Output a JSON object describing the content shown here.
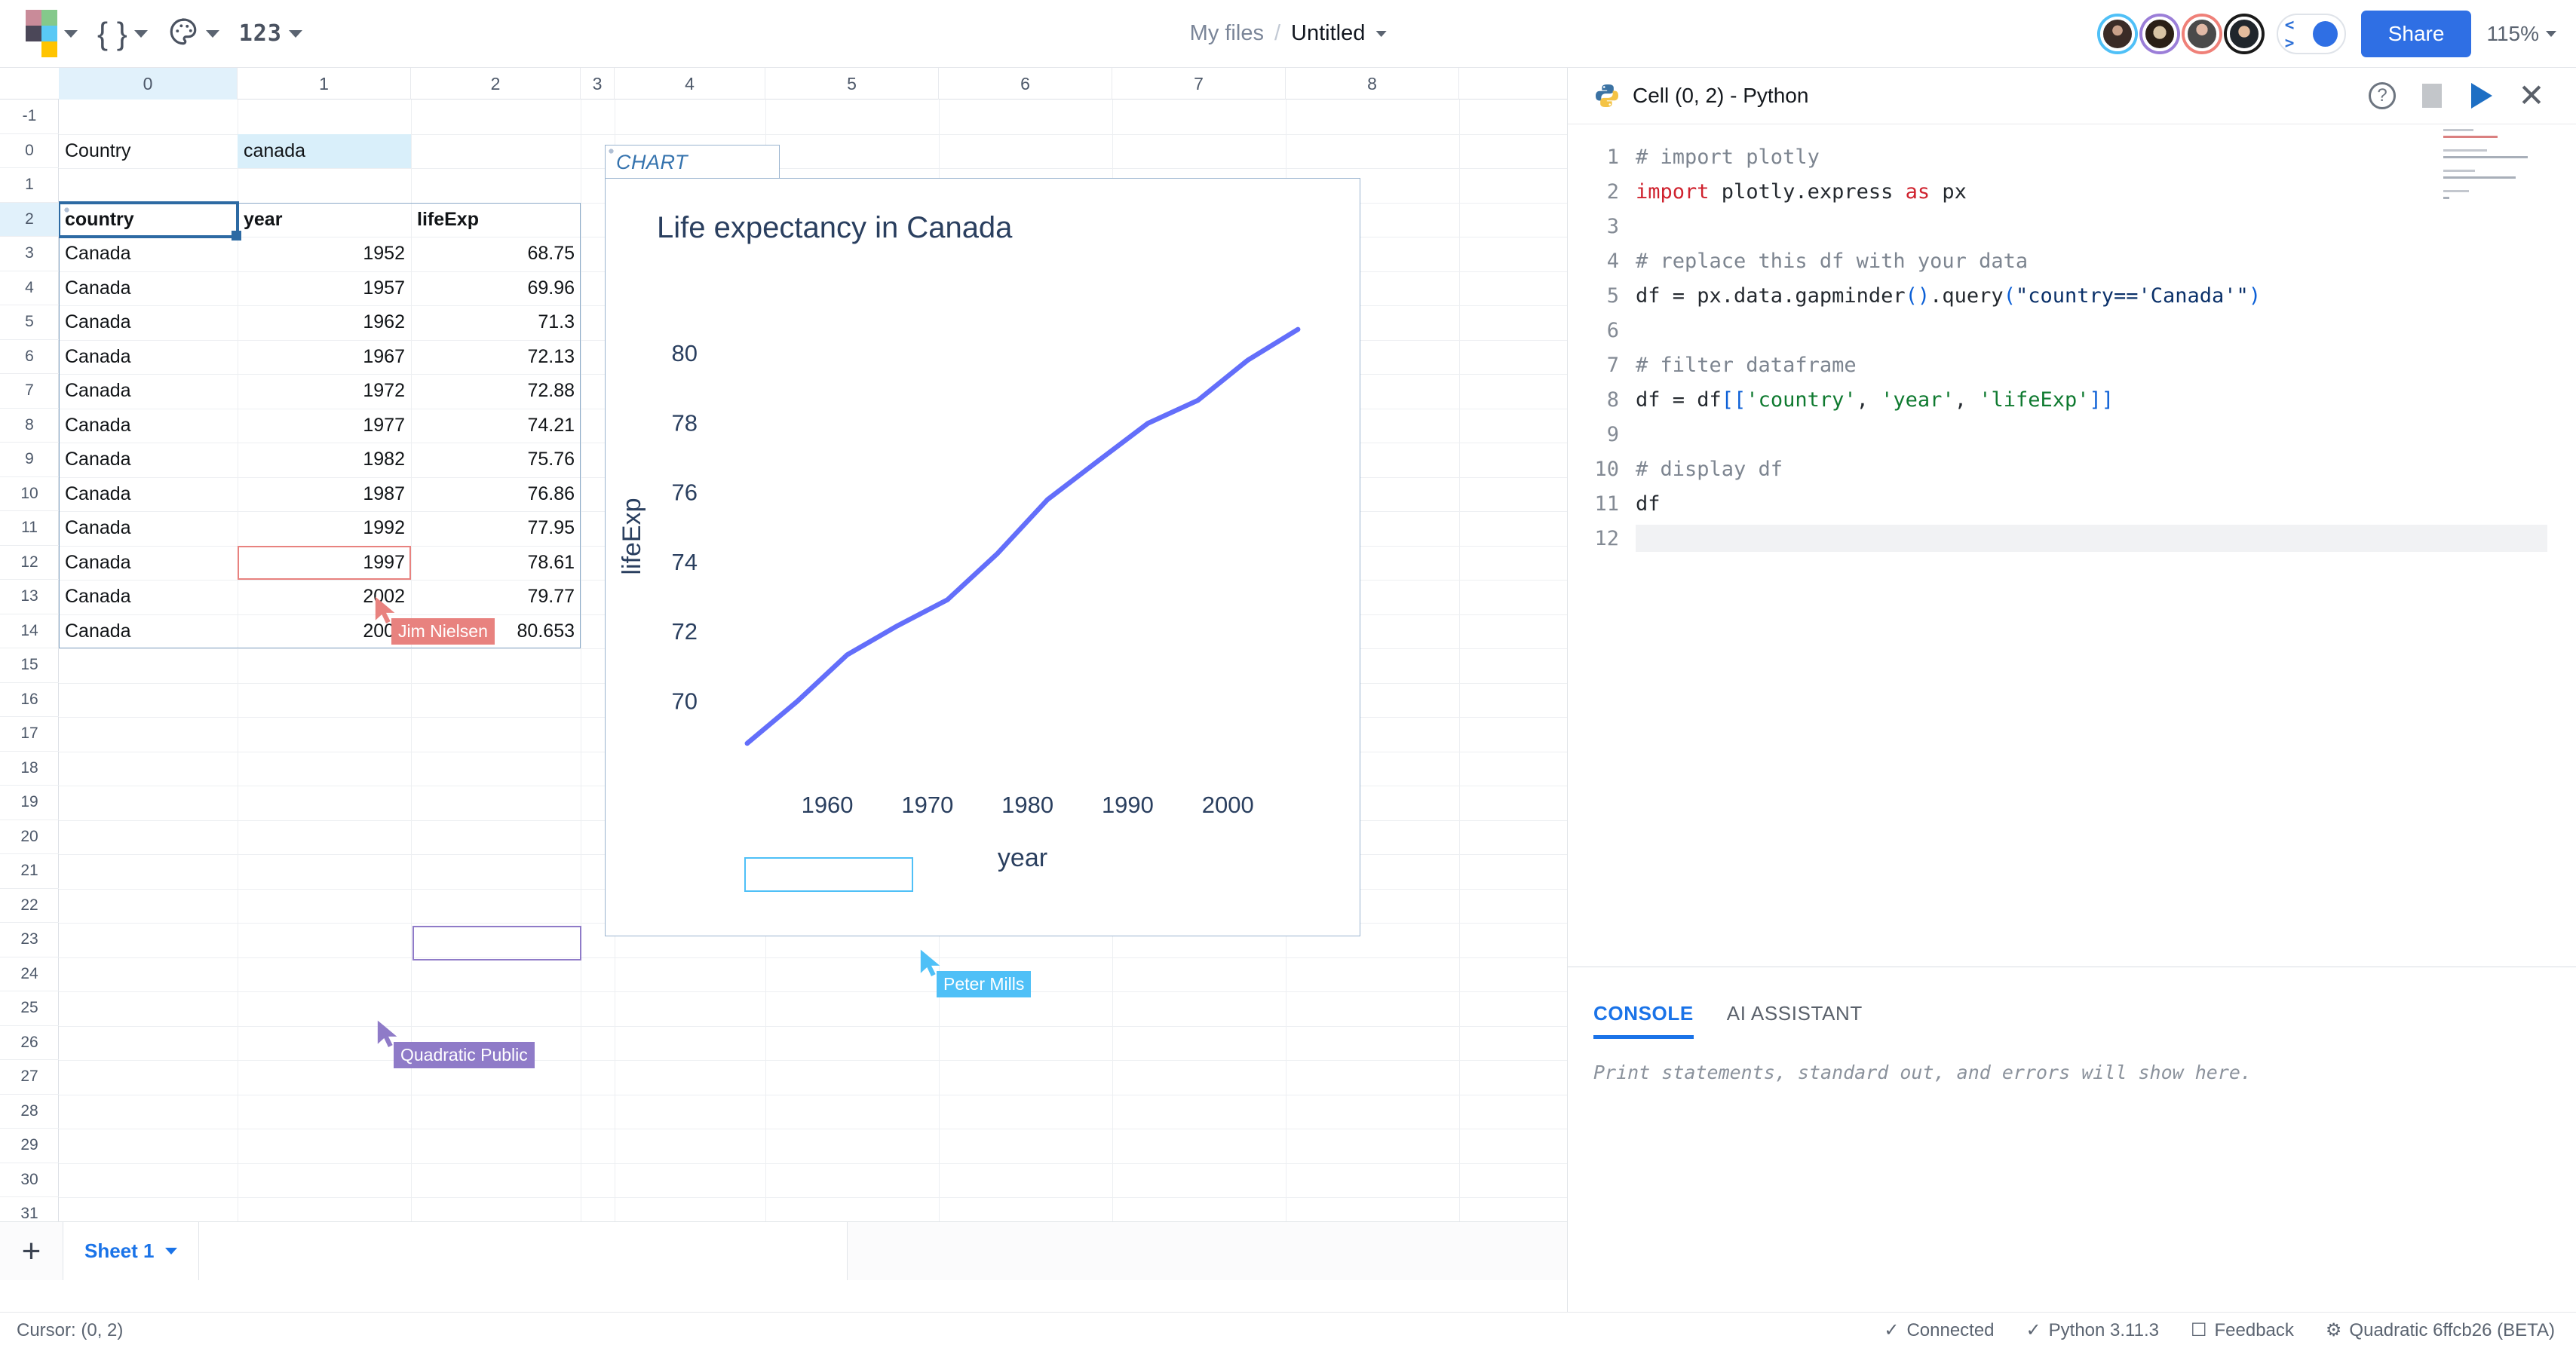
{
  "topbar": {
    "tools": [
      {
        "name": "color-palette-grid",
        "label": ""
      },
      {
        "name": "code-braces",
        "label": "{ }"
      },
      {
        "name": "paint-palette",
        "label": ""
      },
      {
        "name": "number-format",
        "label": "123"
      }
    ],
    "breadcrumb": {
      "root": "My files",
      "separator": "/",
      "title": "Untitled"
    },
    "share_label": "Share",
    "zoom_level": "115%",
    "code_toggle_icon": "< >",
    "avatars": [
      "user-1",
      "user-2",
      "user-3",
      "user-4"
    ]
  },
  "sheet": {
    "column_headers": [
      "0",
      "1",
      "2",
      "3",
      "4",
      "5",
      "6",
      "7",
      "8"
    ],
    "row_headers": [
      "-1",
      "0",
      "1",
      "2",
      "3",
      "4",
      "5",
      "6",
      "7",
      "8",
      "9",
      "10",
      "11",
      "12",
      "13",
      "14",
      "15",
      "16",
      "17",
      "18",
      "19",
      "20",
      "21",
      "22",
      "23",
      "24",
      "25",
      "26",
      "27",
      "28",
      "29",
      "30",
      "31"
    ],
    "param": {
      "label": "Country",
      "value": "canada"
    },
    "table": {
      "headers": [
        "country",
        "year",
        "lifeExp"
      ],
      "rows": [
        [
          "Canada",
          "1952",
          "68.75"
        ],
        [
          "Canada",
          "1957",
          "69.96"
        ],
        [
          "Canada",
          "1962",
          "71.3"
        ],
        [
          "Canada",
          "1967",
          "72.13"
        ],
        [
          "Canada",
          "1972",
          "72.88"
        ],
        [
          "Canada",
          "1977",
          "74.21"
        ],
        [
          "Canada",
          "1982",
          "75.76"
        ],
        [
          "Canada",
          "1987",
          "76.86"
        ],
        [
          "Canada",
          "1992",
          "77.95"
        ],
        [
          "Canada",
          "1997",
          "78.61"
        ],
        [
          "Canada",
          "2002",
          "79.77"
        ],
        [
          "Canada",
          "2007",
          "80.653"
        ]
      ]
    },
    "chart_cell_label": "CHART",
    "collaborators": [
      {
        "name": "Jim Nielsen",
        "color": "#e8827f"
      },
      {
        "name": "Peter Mills",
        "color": "#4fc0f7"
      },
      {
        "name": "Quadratic Public",
        "color": "#8f7bc8"
      }
    ],
    "tabs": {
      "add_label": "+",
      "sheet_name": "Sheet 1"
    }
  },
  "chart_data": {
    "type": "line",
    "title": "Life expectancy in Canada",
    "xlabel": "year",
    "ylabel": "lifeExp",
    "x": [
      1952,
      1957,
      1962,
      1967,
      1972,
      1977,
      1982,
      1987,
      1992,
      1997,
      2002,
      2007
    ],
    "values": [
      68.75,
      69.96,
      71.3,
      72.13,
      72.88,
      74.21,
      75.76,
      76.86,
      77.95,
      78.61,
      79.77,
      80.653
    ],
    "xticks": [
      "1960",
      "1970",
      "1980",
      "1990",
      "2000"
    ],
    "xtick_values": [
      1960,
      1970,
      1980,
      1990,
      2000
    ],
    "yticks": [
      "70",
      "72",
      "74",
      "76",
      "78",
      "80"
    ],
    "ytick_values": [
      70,
      72,
      74,
      76,
      78,
      80
    ],
    "xlim": [
      1949,
      2010
    ],
    "ylim": [
      68.1,
      81.3
    ],
    "line_color": "#636efa",
    "grid": false,
    "legend": false
  },
  "code_panel": {
    "title": "Cell (0, 2) - Python",
    "icons": [
      "python-logo-icon",
      "help-icon",
      "stop-icon",
      "run-icon",
      "close-icon"
    ],
    "lines": [
      {
        "n": "1",
        "text": "# import plotly",
        "type": "comment"
      },
      {
        "n": "2",
        "text": "import plotly.express as px",
        "type": "import"
      },
      {
        "n": "3",
        "text": "",
        "type": "blank"
      },
      {
        "n": "4",
        "text": "# replace this df with your data",
        "type": "comment"
      },
      {
        "n": "5",
        "text": "df = px.data.gapminder().query(\"country=='Canada'\")",
        "type": "code"
      },
      {
        "n": "6",
        "text": "",
        "type": "blank"
      },
      {
        "n": "7",
        "text": "# filter dataframe",
        "type": "comment"
      },
      {
        "n": "8",
        "text": "df = df[['country', 'year', 'lifeExp']]",
        "type": "code"
      },
      {
        "n": "9",
        "text": "",
        "type": "blank"
      },
      {
        "n": "10",
        "text": "# display df",
        "type": "comment"
      },
      {
        "n": "11",
        "text": "df",
        "type": "code"
      },
      {
        "n": "12",
        "text": "",
        "type": "blank"
      }
    ],
    "tabs": [
      {
        "label": "CONSOLE",
        "active": true
      },
      {
        "label": "AI ASSISTANT",
        "active": false
      }
    ],
    "console_placeholder": "Print statements, standard out, and errors will show here."
  },
  "status_bar": {
    "cursor": "Cursor: (0, 2)",
    "items": [
      {
        "icon": "check-icon",
        "label": "Connected"
      },
      {
        "icon": "check-icon",
        "label": "Python 3.11.3"
      },
      {
        "icon": "feedback-icon",
        "label": "Feedback"
      },
      {
        "icon": "version-icon",
        "label": "Quadratic 6ffcb26 (BETA)"
      }
    ]
  }
}
